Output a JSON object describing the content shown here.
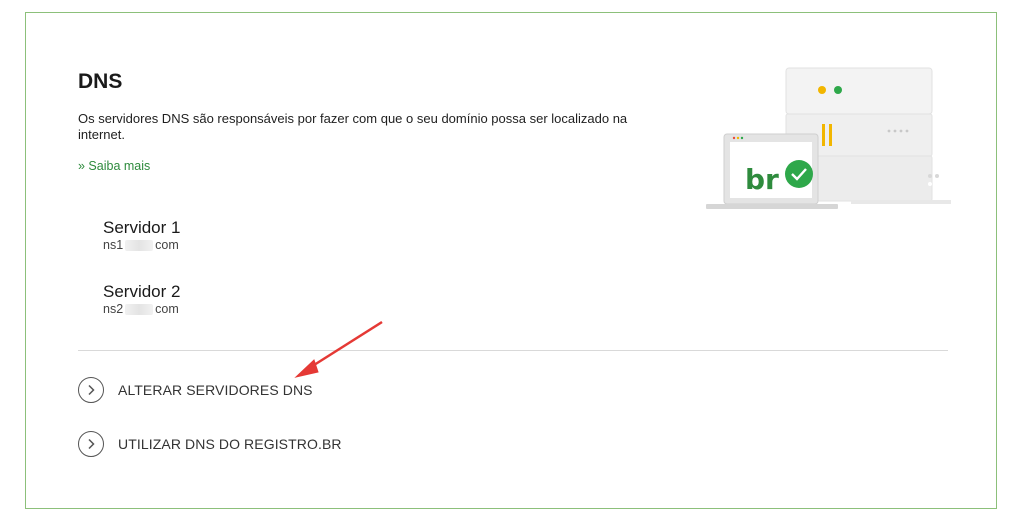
{
  "section": {
    "title": "DNS",
    "description": "Os servidores DNS são responsáveis por fazer com que o seu domínio possa ser localizado na internet.",
    "learn_more": "» Saiba mais"
  },
  "servers": [
    {
      "name": "Servidor 1",
      "host_prefix": "ns1",
      "host_suffix": "com"
    },
    {
      "name": "Servidor 2",
      "host_prefix": "ns2",
      "host_suffix": "com"
    }
  ],
  "actions": [
    {
      "label": "ALTERAR SERVIDORES DNS",
      "icon": "chevron-right-icon"
    },
    {
      "label": "UTILIZAR DNS DO REGISTRO.BR",
      "icon": "chevron-right-icon"
    }
  ],
  "illustration": {
    "logo_text": "br",
    "icons": [
      "server-rack-icon",
      "laptop-icon",
      "check-icon"
    ]
  },
  "annotation": {
    "icon": "red-arrow-icon",
    "color": "#e53935"
  },
  "colors": {
    "brand_green": "#2e8b3d",
    "card_border": "#8cc07a",
    "check_green": "#2ea84a"
  }
}
